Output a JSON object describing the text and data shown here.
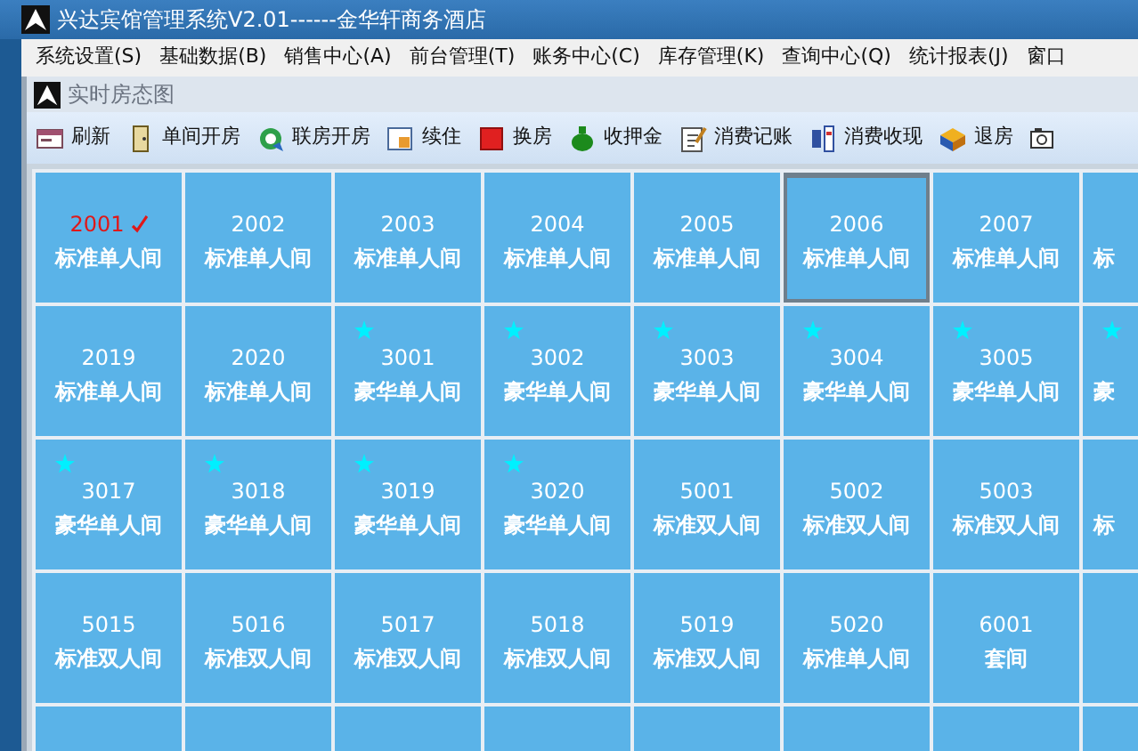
{
  "window": {
    "title": "兴达宾馆管理系统V2.01------金华轩商务酒店"
  },
  "menu": [
    "系统设置(S)",
    "基础数据(B)",
    "销售中心(A)",
    "前台管理(T)",
    "账务中心(C)",
    "库存管理(K)",
    "查询中心(Q)",
    "统计报表(J)",
    "窗口"
  ],
  "panel": {
    "title": "实时房态图"
  },
  "toolbar": [
    {
      "label": "刷新",
      "kind": "refresh"
    },
    {
      "label": "单间开房",
      "kind": "door"
    },
    {
      "label": "联房开房",
      "kind": "link"
    },
    {
      "label": "续住",
      "kind": "extend"
    },
    {
      "label": "换房",
      "kind": "swap"
    },
    {
      "label": "收押金",
      "kind": "money"
    },
    {
      "label": "消费记账",
      "kind": "note"
    },
    {
      "label": "消费收现",
      "kind": "cash"
    },
    {
      "label": "退房",
      "kind": "checkout"
    },
    {
      "kind": "camera"
    }
  ],
  "rooms": [
    {
      "number": "2001",
      "type": "标准单人间",
      "starred": false,
      "occupied": true,
      "selected": false
    },
    {
      "number": "2002",
      "type": "标准单人间",
      "starred": false,
      "occupied": false,
      "selected": false
    },
    {
      "number": "2003",
      "type": "标准单人间",
      "starred": false,
      "occupied": false,
      "selected": false
    },
    {
      "number": "2004",
      "type": "标准单人间",
      "starred": false,
      "occupied": false,
      "selected": false
    },
    {
      "number": "2005",
      "type": "标准单人间",
      "starred": false,
      "occupied": false,
      "selected": false
    },
    {
      "number": "2006",
      "type": "标准单人间",
      "starred": false,
      "occupied": false,
      "selected": true
    },
    {
      "number": "2007",
      "type": "标准单人间",
      "starred": false,
      "occupied": false,
      "selected": false
    },
    {
      "type": "标",
      "starred": false,
      "selected": false
    },
    {
      "number": "2019",
      "type": "标准单人间",
      "starred": false,
      "occupied": false,
      "selected": false
    },
    {
      "number": "2020",
      "type": "标准单人间",
      "starred": false,
      "occupied": false,
      "selected": false
    },
    {
      "number": "3001",
      "type": "豪华单人间",
      "starred": true,
      "occupied": false,
      "selected": false
    },
    {
      "number": "3002",
      "type": "豪华单人间",
      "starred": true,
      "occupied": false,
      "selected": false
    },
    {
      "number": "3003",
      "type": "豪华单人间",
      "starred": true,
      "occupied": false,
      "selected": false
    },
    {
      "number": "3004",
      "type": "豪华单人间",
      "starred": true,
      "occupied": false,
      "selected": false
    },
    {
      "number": "3005",
      "type": "豪华单人间",
      "starred": true,
      "occupied": false,
      "selected": false
    },
    {
      "type": "豪",
      "starred": true,
      "selected": false
    },
    {
      "number": "3017",
      "type": "豪华单人间",
      "starred": true,
      "occupied": false,
      "selected": false
    },
    {
      "number": "3018",
      "type": "豪华单人间",
      "starred": true,
      "occupied": false,
      "selected": false
    },
    {
      "number": "3019",
      "type": "豪华单人间",
      "starred": true,
      "occupied": false,
      "selected": false
    },
    {
      "number": "3020",
      "type": "豪华单人间",
      "starred": true,
      "occupied": false,
      "selected": false
    },
    {
      "number": "5001",
      "type": "标准双人间",
      "starred": false,
      "occupied": false,
      "selected": false
    },
    {
      "number": "5002",
      "type": "标准双人间",
      "starred": false,
      "occupied": false,
      "selected": false
    },
    {
      "number": "5003",
      "type": "标准双人间",
      "starred": false,
      "occupied": false,
      "selected": false
    },
    {
      "type": "标",
      "starred": false,
      "selected": false
    },
    {
      "number": "5015",
      "type": "标准双人间",
      "starred": false,
      "occupied": false,
      "selected": false
    },
    {
      "number": "5016",
      "type": "标准双人间",
      "starred": false,
      "occupied": false,
      "selected": false
    },
    {
      "number": "5017",
      "type": "标准双人间",
      "starred": false,
      "occupied": false,
      "selected": false
    },
    {
      "number": "5018",
      "type": "标准双人间",
      "starred": false,
      "occupied": false,
      "selected": false
    },
    {
      "number": "5019",
      "type": "标准双人间",
      "starred": false,
      "occupied": false,
      "selected": false
    },
    {
      "number": "5020",
      "type": "标准单人间",
      "starred": false,
      "occupied": false,
      "selected": false
    },
    {
      "number": "6001",
      "type": "套间",
      "starred": false,
      "occupied": false,
      "selected": false
    },
    {
      "starred": false,
      "selected": false
    },
    {
      "starred": false,
      "selected": false
    },
    {
      "starred": false,
      "selected": false
    },
    {
      "starred": false,
      "selected": false
    },
    {
      "starred": false,
      "selected": false
    },
    {
      "starred": false,
      "selected": false
    },
    {
      "starred": false,
      "selected": false
    },
    {
      "starred": false,
      "selected": false
    },
    {
      "starred": false,
      "selected": false
    }
  ]
}
